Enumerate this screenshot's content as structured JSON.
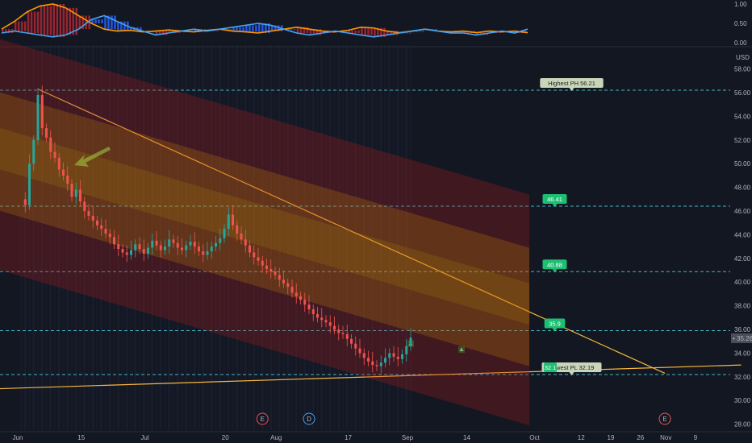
{
  "chart_data": [
    {
      "type": "line",
      "name": "oscillator-pane",
      "y_ticks": [
        "1.00",
        "0.50",
        "0.00"
      ],
      "ylim": [
        0,
        1
      ],
      "series": [
        {
          "role": "orange",
          "values": [
            0.35,
            0.55,
            0.8,
            0.95,
            1.0,
            0.9,
            0.7,
            0.5,
            0.35,
            0.3,
            0.32,
            0.28,
            0.3,
            0.33,
            0.3,
            0.28,
            0.32,
            0.35,
            0.3,
            0.28,
            0.25,
            0.3,
            0.35,
            0.4,
            0.35,
            0.3,
            0.28,
            0.32,
            0.4,
            0.38,
            0.3,
            0.26,
            0.3,
            0.35,
            0.3,
            0.28,
            0.3,
            0.26,
            0.3,
            0.28,
            0.3,
            0.26
          ]
        },
        {
          "role": "blue",
          "values": [
            0.25,
            0.3,
            0.25,
            0.2,
            0.15,
            0.2,
            0.35,
            0.6,
            0.7,
            0.55,
            0.4,
            0.3,
            0.2,
            0.25,
            0.3,
            0.35,
            0.3,
            0.35,
            0.4,
            0.45,
            0.5,
            0.45,
            0.35,
            0.25,
            0.2,
            0.25,
            0.3,
            0.25,
            0.2,
            0.15,
            0.2,
            0.25,
            0.3,
            0.35,
            0.3,
            0.25,
            0.25,
            0.2,
            0.25,
            0.3,
            0.25,
            0.35
          ]
        }
      ]
    },
    {
      "type": "candlestick",
      "name": "price-pane",
      "currency": "USD",
      "y_ticks": [
        "58.00",
        "56.00",
        "54.00",
        "52.00",
        "50.00",
        "48.00",
        "46.00",
        "44.00",
        "42.00",
        "40.00",
        "38.00",
        "36.00",
        "34.00",
        "32.00",
        "30.00",
        "28.00"
      ],
      "ylim": [
        27.5,
        59.2
      ],
      "x_ticks": [
        "Jun",
        "15",
        "Jul",
        "20",
        "Aug",
        "17",
        "Sep",
        "14",
        "Oct",
        "12",
        "19",
        "26",
        "Nov",
        "9"
      ],
      "x_tick_days": [
        0,
        15,
        30,
        49,
        61,
        78,
        92,
        106,
        122,
        133,
        140,
        147,
        153,
        160
      ],
      "last_price": "35.26",
      "trendlines": [
        {
          "from": [
            4,
            56.3
          ],
          "to": [
            152,
            32.3
          ]
        },
        {
          "from": [
            -5,
            31.0
          ],
          "to": [
            170,
            33.0
          ]
        }
      ],
      "levels": [
        {
          "value": 56.21,
          "label": "Highest PH 56.21",
          "label_day": 130,
          "style": "light"
        },
        {
          "value": 46.41,
          "label": "46.41",
          "label_day": 126,
          "style": "green"
        },
        {
          "value": 40.88,
          "label": "40.88",
          "label_day": 126,
          "style": "green"
        },
        {
          "value": 35.9,
          "label": "35.9",
          "label_day": 126,
          "style": "green"
        },
        {
          "value": 32.19,
          "label": "Lowest PL 32.19",
          "label_day": 130,
          "style": "light",
          "extra_label": "32.1"
        }
      ],
      "events": [
        {
          "label": "E",
          "day": 57
        },
        {
          "label": "D",
          "day": 68
        },
        {
          "label": "E",
          "day": 152
        }
      ],
      "signals": [
        {
          "day": 92,
          "price": 34.8,
          "type": "up"
        },
        {
          "day": 104,
          "price": 34.3,
          "type": "up"
        }
      ],
      "series": [
        {
          "role": "close",
          "values": [
            47,
            46.5,
            50,
            52,
            55.8,
            53,
            52.2,
            51,
            50.5,
            49.5,
            49,
            48.3,
            47.2,
            47.8,
            46.8,
            46,
            45.6,
            45.2,
            44.8,
            44.5,
            44.1,
            43.8,
            43.2,
            42.8,
            42.5,
            42.3,
            42.7,
            43.2,
            42.8,
            42.4,
            42.9,
            43.5,
            43.1,
            42.7,
            43,
            43.6,
            43.3,
            42.9,
            42.7,
            43.1,
            43.4,
            43,
            42.6,
            42.3,
            42.6,
            43,
            43.3,
            43.7,
            44.5,
            45.7,
            44.8,
            44.1,
            43.6,
            43.1,
            42.5,
            42.1,
            41.8,
            41.4,
            41.1,
            40.9,
            40.6,
            40.2,
            39.9,
            39.6,
            39.1,
            38.8,
            38.5,
            38.1,
            37.7,
            37.3,
            37,
            36.8,
            36.6,
            36.3,
            36,
            35.7,
            35.6,
            35.2,
            34.8,
            34.4,
            34,
            33.6,
            33.3,
            33,
            32.9,
            33.2,
            33.6,
            34,
            33.7,
            33.5,
            33.9,
            34.6,
            35.3
          ]
        }
      ]
    }
  ]
}
